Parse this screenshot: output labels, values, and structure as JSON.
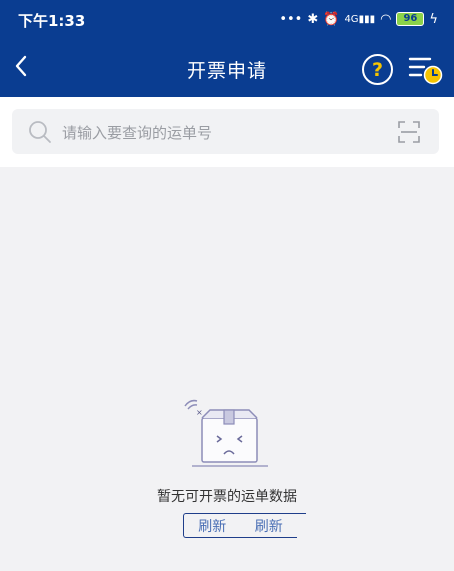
{
  "status_bar": {
    "time": "下午1:33",
    "network": "4G",
    "battery": "96"
  },
  "header": {
    "title": "开票申请",
    "help_glyph": "?",
    "icons": [
      "back-icon",
      "help-icon",
      "history-icon"
    ]
  },
  "search": {
    "placeholder": "请输入要查询的运单号",
    "value": ""
  },
  "empty_state": {
    "message": "暂无可开票的运单数据",
    "refresh_labels": [
      "刷新",
      "刷新"
    ]
  },
  "colors": {
    "header_bg": "#0a3d91",
    "accent_yellow": "#f5c400",
    "button_text": "#4a6fb5",
    "page_bg": "#f2f2f4"
  }
}
